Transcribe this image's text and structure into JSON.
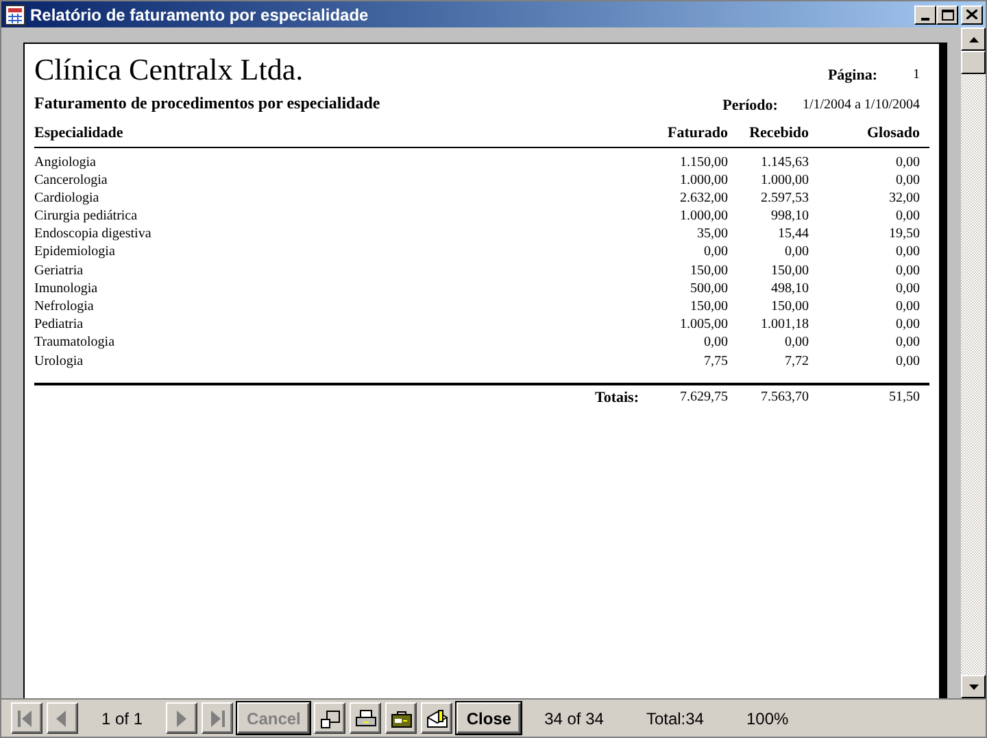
{
  "window": {
    "title": "Relatório de faturamento por especialidade"
  },
  "report": {
    "company": "Clínica Centralx Ltda.",
    "subtitle": "Faturamento de procedimentos por especialidade",
    "page_label": "Página:",
    "page_value": "1",
    "period_label": "Período:",
    "period_value": "1/1/2004 a 1/10/2004",
    "columns": [
      "Especialidade",
      "Faturado",
      "Recebido",
      "Glosado"
    ],
    "rows": [
      [
        "Angiologia",
        "1.150,00",
        "1.145,63",
        "0,00"
      ],
      [
        "Cancerologia",
        "1.000,00",
        "1.000,00",
        "0,00"
      ],
      [
        "Cardiologia",
        "2.632,00",
        "2.597,53",
        "32,00"
      ],
      [
        "Cirurgia pediátrica",
        "1.000,00",
        "998,10",
        "0,00"
      ],
      [
        "Endoscopia digestiva",
        "35,00",
        "15,44",
        "19,50"
      ],
      [
        "Epidemiologia",
        "0,00",
        "0,00",
        "0,00"
      ],
      [
        "Geriatria",
        "150,00",
        "150,00",
        "0,00"
      ],
      [
        "Imunologia",
        "500,00",
        "498,10",
        "0,00"
      ],
      [
        "Nefrologia",
        "150,00",
        "150,00",
        "0,00"
      ],
      [
        "Pediatria",
        "1.005,00",
        "1.001,18",
        "0,00"
      ],
      [
        "Traumatologia",
        "0,00",
        "0,00",
        "0,00"
      ],
      [
        "Urologia",
        "7,75",
        "7,72",
        "0,00"
      ]
    ],
    "totals": [
      "Totais:",
      "7.629,75",
      "7.563,70",
      "51,50"
    ]
  },
  "toolbar": [
    {
      "kind": "first",
      "disabled": true
    },
    {
      "kind": "prev",
      "disabled": true
    },
    {
      "kind": "text",
      "label": "1 of 1"
    },
    {
      "kind": "next",
      "disabled": true
    },
    {
      "kind": "last",
      "disabled": true
    },
    {
      "kind": "button",
      "label": "Cancel",
      "disabled": true
    },
    {
      "kind": "zoom-window"
    },
    {
      "kind": "print"
    },
    {
      "kind": "export"
    },
    {
      "kind": "mail"
    },
    {
      "kind": "button",
      "label": "Close",
      "disabled": false
    },
    {
      "kind": "text",
      "label": "34 of 34"
    },
    {
      "kind": "text",
      "label": "Total:34"
    },
    {
      "kind": "text",
      "label": "100%"
    }
  ]
}
